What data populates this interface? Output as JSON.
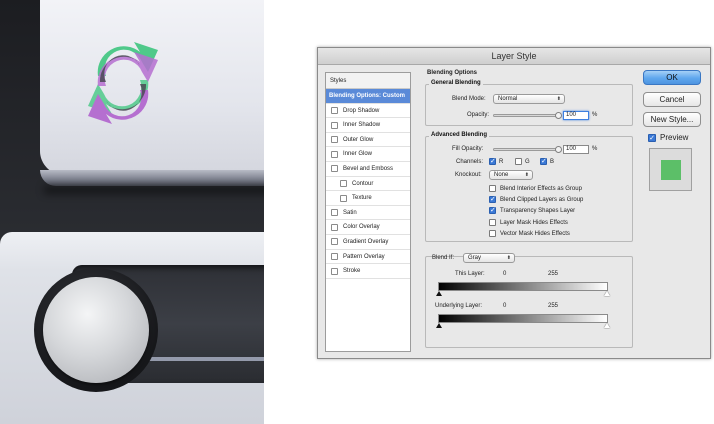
{
  "dialog": {
    "title": "Layer Style",
    "styles_header": "Styles",
    "styles": [
      {
        "label": "Blending Options: Custom",
        "selected": true,
        "checkbox": false,
        "sub": false
      },
      {
        "label": "Drop Shadow",
        "selected": false,
        "checkbox": true,
        "sub": false
      },
      {
        "label": "Inner Shadow",
        "selected": false,
        "checkbox": true,
        "sub": false
      },
      {
        "label": "Outer Glow",
        "selected": false,
        "checkbox": true,
        "sub": false
      },
      {
        "label": "Inner Glow",
        "selected": false,
        "checkbox": true,
        "sub": false
      },
      {
        "label": "Bevel and Emboss",
        "selected": false,
        "checkbox": true,
        "sub": false
      },
      {
        "label": "Contour",
        "selected": false,
        "checkbox": true,
        "sub": true
      },
      {
        "label": "Texture",
        "selected": false,
        "checkbox": true,
        "sub": true
      },
      {
        "label": "Satin",
        "selected": false,
        "checkbox": true,
        "sub": false
      },
      {
        "label": "Color Overlay",
        "selected": false,
        "checkbox": true,
        "sub": false
      },
      {
        "label": "Gradient Overlay",
        "selected": false,
        "checkbox": true,
        "sub": false
      },
      {
        "label": "Pattern Overlay",
        "selected": false,
        "checkbox": true,
        "sub": false
      },
      {
        "label": "Stroke",
        "selected": false,
        "checkbox": true,
        "sub": false
      }
    ],
    "blending": {
      "section_title": "Blending Options",
      "general_title": "General Blending",
      "blend_mode_label": "Blend Mode:",
      "blend_mode_value": "Normal",
      "opacity_label": "Opacity:",
      "opacity_value": "100",
      "opacity_fraction": 1.0,
      "percent": "%",
      "advanced_title": "Advanced Blending",
      "fill_opacity_label": "Fill Opacity:",
      "fill_opacity_value": "100",
      "fill_opacity_fraction": 1.0,
      "channels_label": "Channels:",
      "channel_r": "R",
      "channel_g": "G",
      "channel_b": "B",
      "knockout_label": "Knockout:",
      "knockout_value": "None",
      "options": [
        {
          "label": "Blend Interior Effects as Group",
          "checked": false
        },
        {
          "label": "Blend Clipped Layers as Group",
          "checked": true
        },
        {
          "label": "Transparency Shapes Layer",
          "checked": true
        },
        {
          "label": "Layer Mask Hides Effects",
          "checked": false
        },
        {
          "label": "Vector Mask Hides Effects",
          "checked": false
        }
      ],
      "blend_if_label": "Blend If:",
      "blend_if_value": "Gray",
      "this_layer_label": "This Layer:",
      "underlying_label": "Underlying Layer:",
      "range_min": "0",
      "range_max": "255"
    },
    "buttons": {
      "ok": "OK",
      "cancel": "Cancel",
      "new_style": "New Style...",
      "preview": "Preview"
    }
  },
  "colors": {
    "accent_blue": "#3b79d6",
    "selected_row": "#5a8ad8",
    "preview_swatch": "#5cbf68",
    "icon_green": "#4fc98a",
    "icon_purple": "#b56fd0"
  },
  "icons": {
    "artwork_icon": "refresh-icon"
  }
}
